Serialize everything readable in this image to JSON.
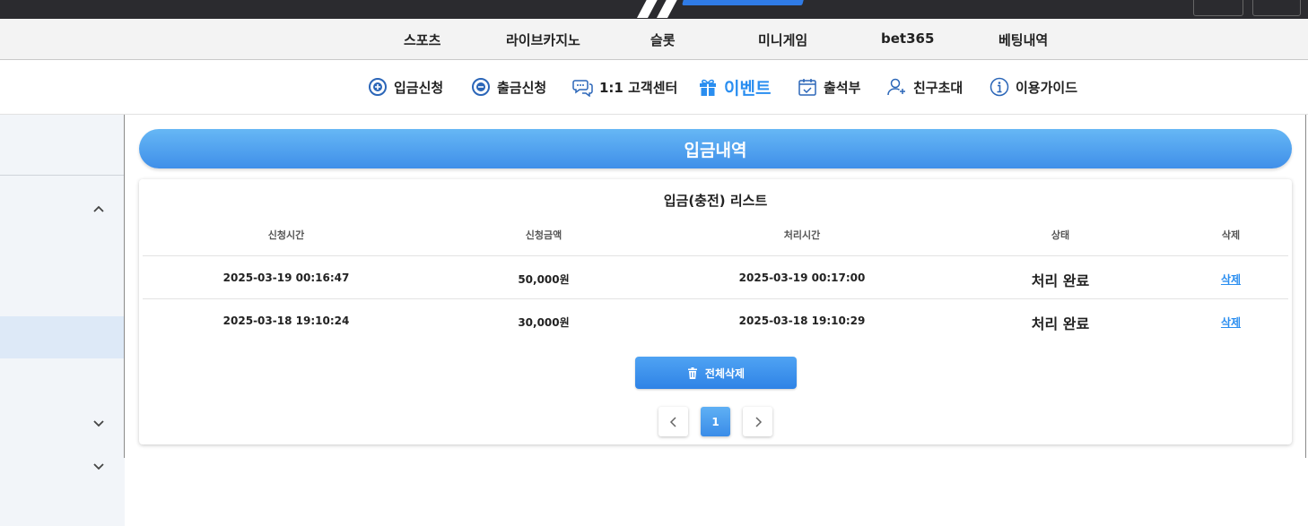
{
  "main_nav": [
    "스포츠",
    "라이브카지노",
    "슬롯",
    "미니게임",
    "bet365",
    "베팅내역"
  ],
  "sub_nav": {
    "deposit": "입금신청",
    "withdraw": "출금신청",
    "support": "1:1 고객센터",
    "event": "이벤트",
    "attendance": "출석부",
    "invite": "친구초대",
    "guide": "이용가이드"
  },
  "page_title": "입금내역",
  "list_title": "입금(충전) 리스트",
  "table": {
    "headers": [
      "신청시간",
      "신청금액",
      "처리시간",
      "상태",
      "삭제"
    ],
    "rows": [
      [
        "2025-03-19 00:16:47",
        "50,000원",
        "2025-03-19 00:17:00",
        "처리 완료",
        "삭제"
      ],
      [
        "2025-03-18 19:10:24",
        "30,000원",
        "2025-03-18 19:10:29",
        "처리 완료",
        "삭제"
      ]
    ]
  },
  "delete_all_label": "전체삭제",
  "pagination": {
    "current": "1"
  },
  "colors": {
    "accent": "#2a8ef0",
    "title_bar": "#4fa3f0",
    "topbar": "#2b2b2f"
  },
  "icons": [
    "plus-circle-icon",
    "minus-circle-icon",
    "chat-icon",
    "gift-icon",
    "calendar-check-icon",
    "user-plus-icon",
    "info-icon",
    "trash-icon",
    "chevron-up-icon",
    "chevron-down-icon",
    "chevron-left-icon",
    "chevron-right-icon"
  ]
}
